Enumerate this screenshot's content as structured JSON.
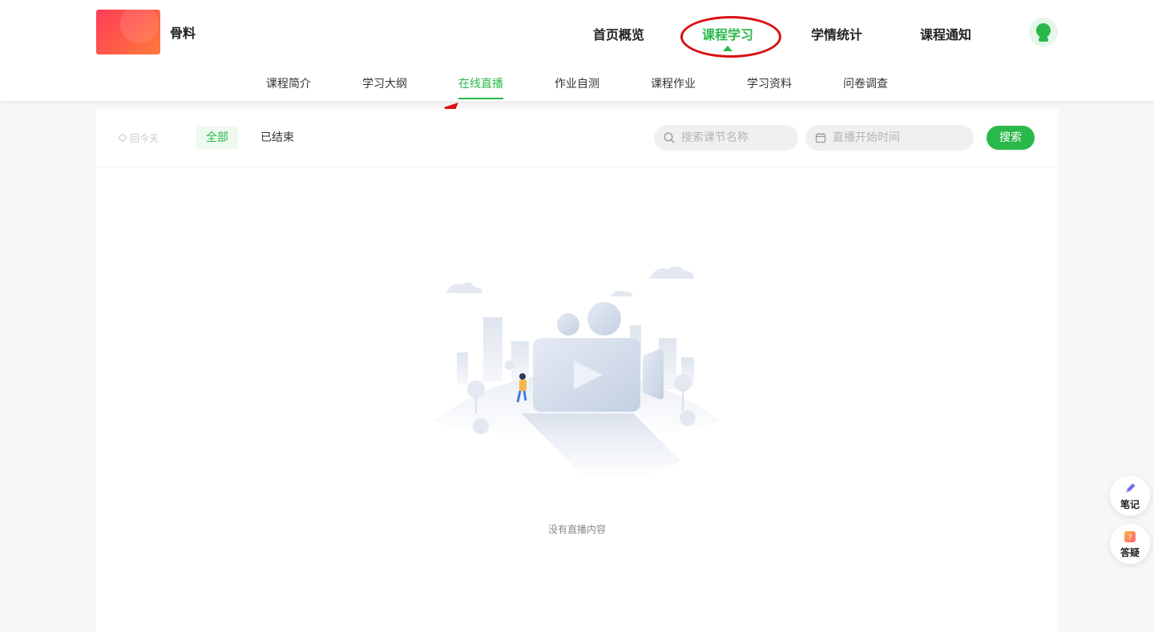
{
  "course": {
    "name": "骨料"
  },
  "top_nav": {
    "items": [
      {
        "label": "首页概览",
        "active": false
      },
      {
        "label": "课程学习",
        "active": true
      },
      {
        "label": "学情统计",
        "active": false
      },
      {
        "label": "课程通知",
        "active": false
      }
    ]
  },
  "sub_nav": {
    "items": [
      {
        "label": "课程简介",
        "active": false
      },
      {
        "label": "学习大纲",
        "active": false
      },
      {
        "label": "在线直播",
        "active": true
      },
      {
        "label": "作业自测",
        "active": false
      },
      {
        "label": "课程作业",
        "active": false
      },
      {
        "label": "学习资料",
        "active": false
      },
      {
        "label": "问卷调查",
        "active": false
      }
    ]
  },
  "toolbar": {
    "back_today": "回今天",
    "filters": [
      {
        "label": "全部",
        "active": true
      },
      {
        "label": "已结束",
        "active": false
      }
    ],
    "search_placeholder": "搜索课节名称",
    "date_placeholder": "直播开始时间",
    "search_button": "搜索"
  },
  "empty_state": {
    "message": "没有直播内容"
  },
  "floating": {
    "notes": "笔记",
    "qa": "答疑"
  },
  "colors": {
    "accent": "#2bb84a",
    "annotation": "#d90f12"
  }
}
